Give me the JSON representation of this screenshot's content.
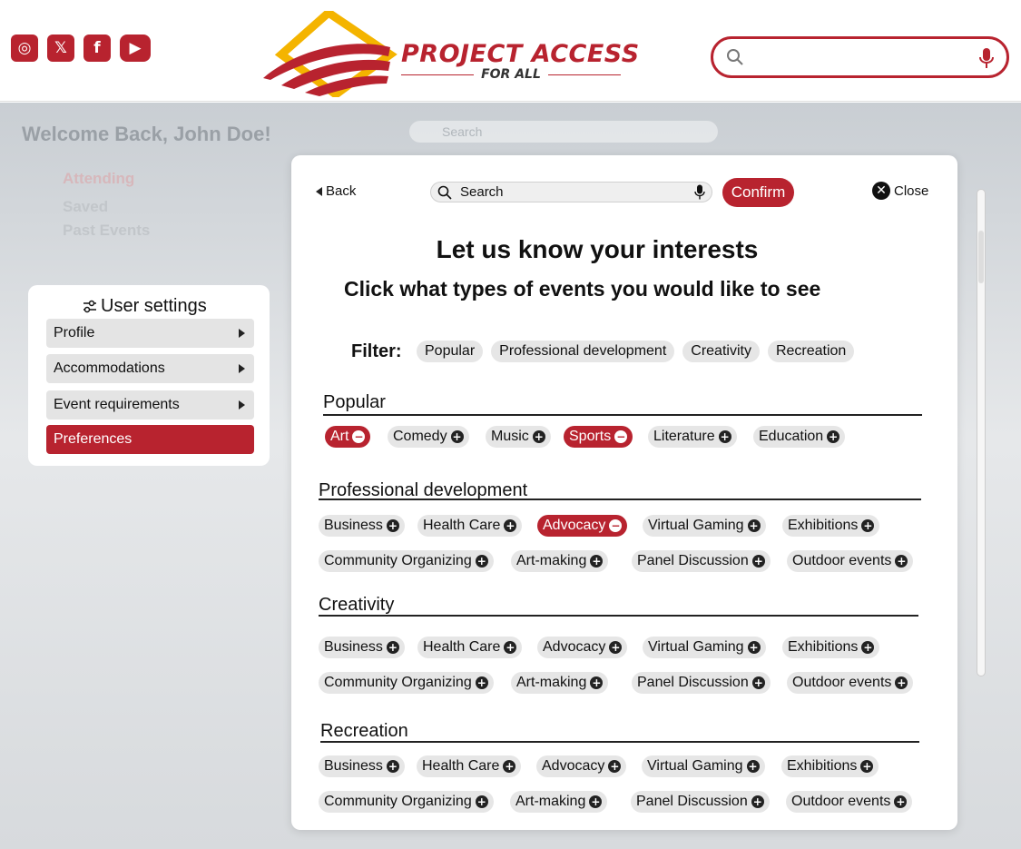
{
  "header": {
    "social": [
      {
        "name": "instagram-icon",
        "glyph": "◎"
      },
      {
        "name": "x-icon",
        "glyph": "𝕏"
      },
      {
        "name": "facebook-icon",
        "glyph": "f"
      },
      {
        "name": "youtube-icon",
        "glyph": "▶"
      }
    ],
    "logo_title": "PROJECT ACCESS",
    "logo_sub": "FOR ALL",
    "search_placeholder": ""
  },
  "background": {
    "welcome": "Welcome Back, John Doe!",
    "search_placeholder": "Search",
    "nav": [
      "Attending",
      "Saved",
      "Past Events"
    ]
  },
  "settings": {
    "title": "User settings",
    "items": [
      {
        "label": "Profile",
        "active": false
      },
      {
        "label": "Accommodations",
        "active": false
      },
      {
        "label": "Event requirements",
        "active": false
      },
      {
        "label": "Preferences",
        "active": true
      }
    ]
  },
  "modal": {
    "back": "Back",
    "search": "Search",
    "confirm": "Confirm",
    "close": "Close",
    "title": "Let us know your interests",
    "subtitle": "Click what types of events you would like to see",
    "filter_label": "Filter:",
    "filters": [
      "Popular",
      "Professional development",
      "Creativity",
      "Recreation"
    ],
    "sections": [
      {
        "heading": "Popular",
        "rows": [
          [
            {
              "label": "Art",
              "selected": true
            },
            {
              "label": "Comedy",
              "selected": false
            },
            {
              "label": "Music",
              "selected": false
            },
            {
              "label": "Sports",
              "selected": true
            },
            {
              "label": "Literature",
              "selected": false
            },
            {
              "label": "Education",
              "selected": false
            }
          ]
        ]
      },
      {
        "heading": "Professional development",
        "rows": [
          [
            {
              "label": "Business",
              "selected": false
            },
            {
              "label": "Health Care",
              "selected": false
            },
            {
              "label": "Advocacy",
              "selected": true
            },
            {
              "label": "Virtual Gaming",
              "selected": false
            },
            {
              "label": "Exhibitions",
              "selected": false
            }
          ],
          [
            {
              "label": "Community Organizing",
              "selected": false
            },
            {
              "label": "Art-making",
              "selected": false
            },
            {
              "label": "Panel Discussion",
              "selected": false
            },
            {
              "label": "Outdoor events",
              "selected": false
            }
          ]
        ]
      },
      {
        "heading": "Creativity",
        "rows": [
          [
            {
              "label": "Business",
              "selected": false
            },
            {
              "label": "Health Care",
              "selected": false
            },
            {
              "label": "Advocacy",
              "selected": false
            },
            {
              "label": "Virtual Gaming",
              "selected": false
            },
            {
              "label": "Exhibitions",
              "selected": false
            }
          ],
          [
            {
              "label": "Community Organizing",
              "selected": false
            },
            {
              "label": "Art-making",
              "selected": false
            },
            {
              "label": "Panel Discussion",
              "selected": false
            },
            {
              "label": "Outdoor events",
              "selected": false
            }
          ]
        ]
      },
      {
        "heading": "Recreation",
        "rows": [
          [
            {
              "label": "Business",
              "selected": false
            },
            {
              "label": "Health Care",
              "selected": false
            },
            {
              "label": "Advocacy",
              "selected": false
            },
            {
              "label": "Virtual Gaming",
              "selected": false
            },
            {
              "label": "Exhibitions",
              "selected": false
            }
          ],
          [
            {
              "label": "Community Organizing",
              "selected": false
            },
            {
              "label": "Art-making",
              "selected": false
            },
            {
              "label": "Panel Discussion",
              "selected": false
            },
            {
              "label": "Outdoor events",
              "selected": false
            }
          ]
        ]
      }
    ]
  },
  "colors": {
    "brand_red": "#b8232f",
    "logo_gold": "#f4b400",
    "chip_bg": "#e6e6e6"
  }
}
